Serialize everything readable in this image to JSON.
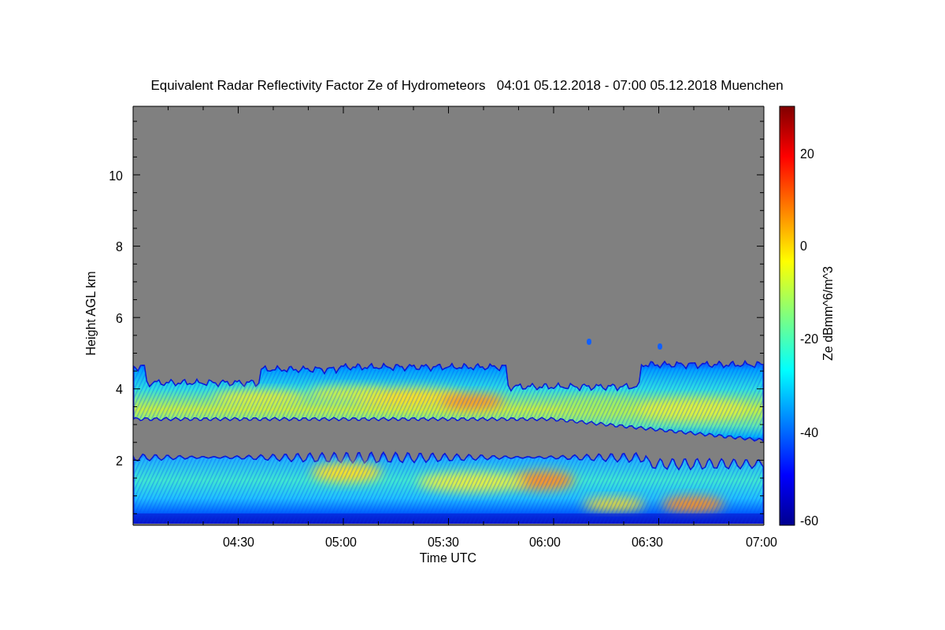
{
  "chart": {
    "title": "Equivalent Radar Reflectivity Factor Ze of Hydrometeors   04:01 05.12.2018 - 07:00 05.12.2018 Muenchen",
    "ylabel": "Height AGL km",
    "xlabel": "Time UTC",
    "yticks": [
      "10",
      "8",
      "6",
      "4",
      "2"
    ],
    "xticks": [
      "04:30",
      "05:00",
      "05:30",
      "06:00",
      "06:30",
      "07:00"
    ],
    "colorbar": {
      "label": "Ze dBmm^6/m^3",
      "ticks": [
        "20",
        "0",
        "-20",
        "-40",
        "-60"
      ]
    }
  }
}
